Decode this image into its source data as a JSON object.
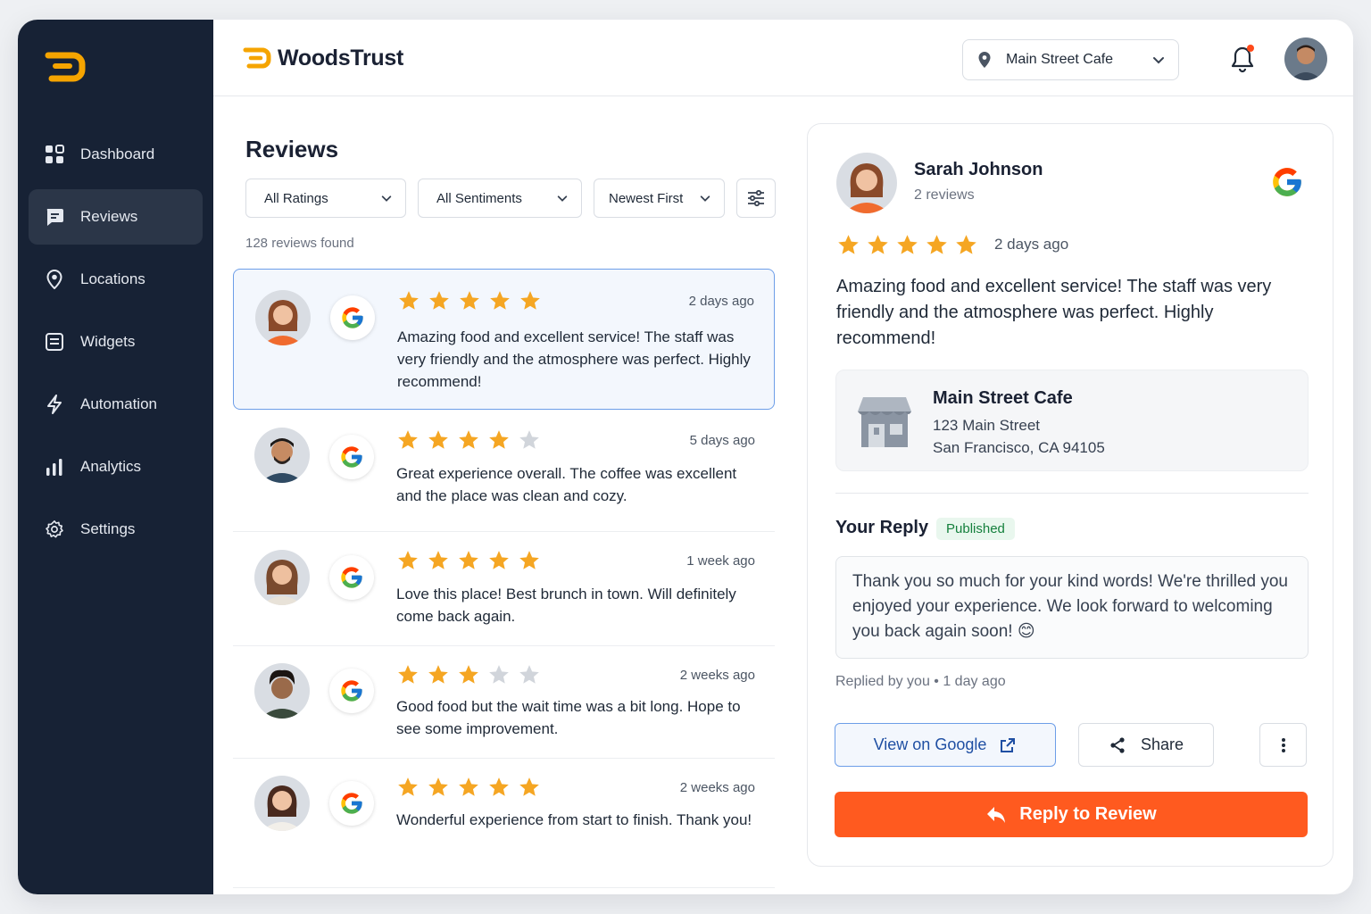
{
  "app": {
    "brand_name": "WoodsTrust",
    "accent": "#ff5a1f",
    "sidebar_bg": "#172235",
    "star_color": "#f5a623"
  },
  "sidebar": {
    "logo": "brand-logo-icon",
    "items": [
      {
        "label": "Dashboard",
        "icon": "dashboard-icon",
        "active": false
      },
      {
        "label": "Reviews",
        "icon": "reviews-icon",
        "active": true
      },
      {
        "label": "Locations",
        "icon": "location-pin-icon",
        "active": false
      },
      {
        "label": "Widgets",
        "icon": "widgets-icon",
        "active": false
      },
      {
        "label": "Automation",
        "icon": "lightning-icon",
        "active": false
      },
      {
        "label": "Analytics",
        "icon": "bar-chart-icon",
        "active": false
      },
      {
        "label": "Settings",
        "icon": "gear-icon",
        "active": false
      }
    ]
  },
  "header": {
    "location_select": "Main Street Cafe",
    "has_notification": true
  },
  "reviews": {
    "title": "Reviews",
    "filters": {
      "rating": "All Ratings",
      "sentiment": "All Sentiments",
      "sort": "Newest First"
    },
    "count_text": "128 reviews found",
    "items": [
      {
        "rating": 5,
        "time": "2 days ago",
        "text": "Amazing food and excellent service! The staff was very friendly and the atmosphere was perfect. Highly recommend!",
        "source": "google",
        "selected": true
      },
      {
        "rating": 4,
        "time": "5 days ago",
        "text": "Great experience overall. The coffee was excellent and the place was clean and cozy.",
        "source": "google",
        "selected": false
      },
      {
        "rating": 5,
        "time": "1 week ago",
        "text": "Love this place! Best brunch in town. Will definitely come back again.",
        "source": "google",
        "selected": false
      },
      {
        "rating": 3,
        "time": "2 weeks ago",
        "text": "Good food but the wait time was a bit long. Hope to see some improvement.",
        "source": "google",
        "selected": false
      },
      {
        "rating": 5,
        "time": "2 weeks ago",
        "text": "Wonderful experience from start to finish. Thank you!",
        "source": "google",
        "selected": false
      }
    ]
  },
  "detail": {
    "name": "Sarah Johnson",
    "review_count": "2 reviews",
    "rating": 5,
    "time": "2 days ago",
    "text": "Amazing food and excellent service! The staff was very friendly and the atmosphere was perfect. Highly recommend!",
    "location": {
      "name": "Main Street Cafe",
      "address_line1": "123 Main Street",
      "address_line2": "San Francisco, CA 94105"
    },
    "reply": {
      "title": "Your Reply",
      "status": "Published",
      "text": "Thank you so much for your kind words! We're thrilled you enjoyed your experience. We look forward to welcoming you back again soon! 😊",
      "meta": "Replied by you • 1 day ago"
    },
    "actions": {
      "view_google": "View on Google",
      "share": "Share",
      "reply": "Reply to Review"
    }
  }
}
